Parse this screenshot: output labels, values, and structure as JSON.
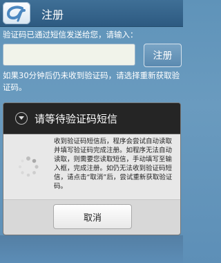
{
  "header": {
    "title": "注册",
    "logo_icon": "app-logo-icon"
  },
  "form": {
    "hint_text": "验证码已通过短信发送给您，请输入：",
    "code_input": {
      "value": "",
      "placeholder": ""
    },
    "register_label": "注册",
    "resend_hint": "如果30分钟后仍未收到验证码，请选择重新获取验证码。"
  },
  "dialog": {
    "title": "请等待验证码短信",
    "message": "收到验证码短信后，程序会尝试自动读取并填写验证码完成注册。如程序无法自动读取，则需要您读取短信，手动填写至输入框，完成注册。如仍无法收到验证码短信，请点击“取消”后，尝试重新获取验证码。",
    "cancel_label": "取消",
    "icon": "chevron-down-circle-icon"
  },
  "colors": {
    "background": "#6a9bbf",
    "titlebar": "#2d5a81",
    "dialog_dark": "#242424",
    "dialog_light": "#e8e8e8"
  }
}
